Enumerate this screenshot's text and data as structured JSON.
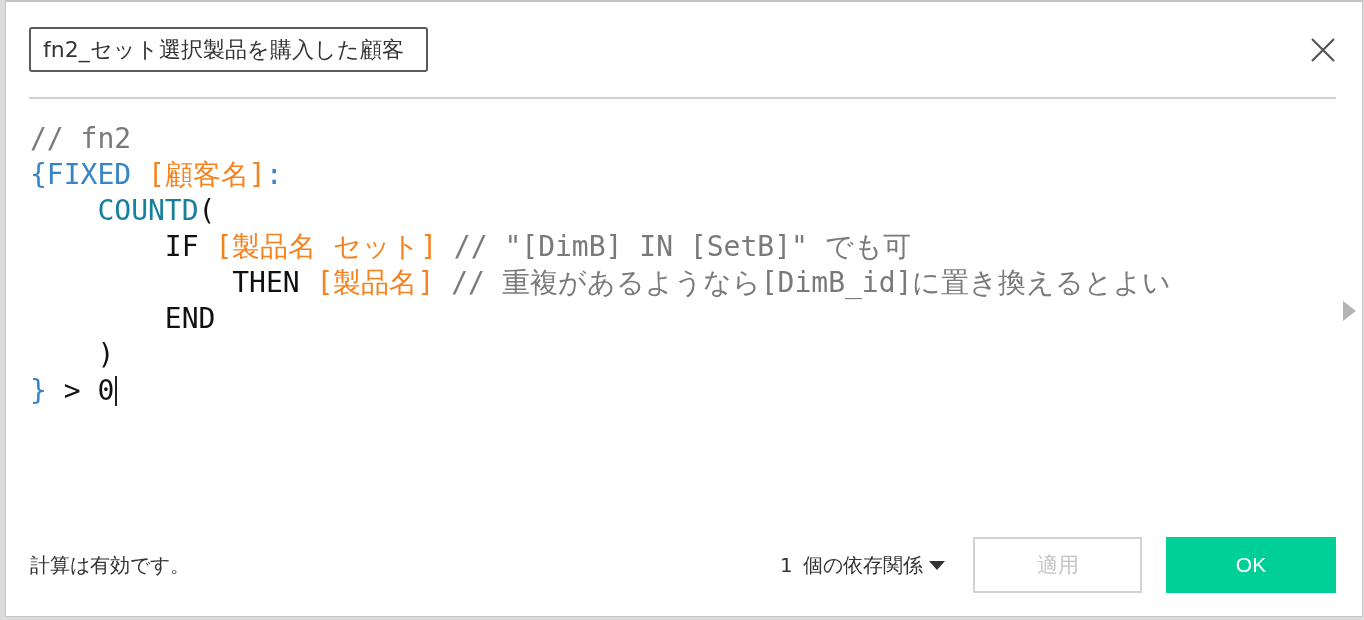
{
  "dialog": {
    "title_field": {
      "value": "fn2_セット選択製品を購入した顧客"
    },
    "code": {
      "lines": [
        {
          "tokens": [
            {
              "kind": "comment",
              "text": "// fn2"
            }
          ],
          "cursor": false
        },
        {
          "tokens": [
            {
              "kind": "keyword",
              "text": "{FIXED"
            },
            {
              "kind": "field",
              "text": "[顧客名]"
            },
            {
              "kind": "keyword",
              "text": ":",
              "attached": true
            }
          ],
          "cursor": false,
          "children": [
            {
              "tokens": [
                {
                  "kind": "function",
                  "text": "COUNTD"
                },
                {
                  "kind": "plain",
                  "text": "(",
                  "attached": true
                }
              ],
              "cursor": false,
              "children": [
                {
                  "tokens": [
                    {
                      "kind": "plain",
                      "text": "IF"
                    },
                    {
                      "kind": "field",
                      "text": "[製品名 セット]"
                    },
                    {
                      "kind": "comment",
                      "text": "// \"[DimB] IN [SetB]\" でも可"
                    }
                  ],
                  "cursor": false,
                  "children": [
                    {
                      "tokens": [
                        {
                          "kind": "plain",
                          "text": "THEN"
                        },
                        {
                          "kind": "field",
                          "text": "[製品名]"
                        },
                        {
                          "kind": "comment",
                          "text": "// 重複があるようなら[DimB_id]に置き換えるとよい"
                        }
                      ],
                      "cursor": false
                    }
                  ]
                },
                {
                  "tokens": [
                    {
                      "kind": "plain",
                      "text": "END"
                    }
                  ],
                  "cursor": false
                }
              ]
            },
            {
              "tokens": [
                {
                  "kind": "plain",
                  "text": ")"
                }
              ],
              "cursor": false
            }
          ]
        },
        {
          "tokens": [
            {
              "kind": "keyword",
              "text": "}"
            },
            {
              "kind": "plain",
              "text": "> 0"
            }
          ],
          "cursor": true
        }
      ]
    },
    "status": "計算は有効です。",
    "dependencies": {
      "label": "1 個の依存関係"
    },
    "buttons": [
      {
        "label": "適用",
        "kind": "secondary",
        "disabled": true
      },
      {
        "label": "OK",
        "kind": "primary",
        "disabled": false
      }
    ]
  }
}
